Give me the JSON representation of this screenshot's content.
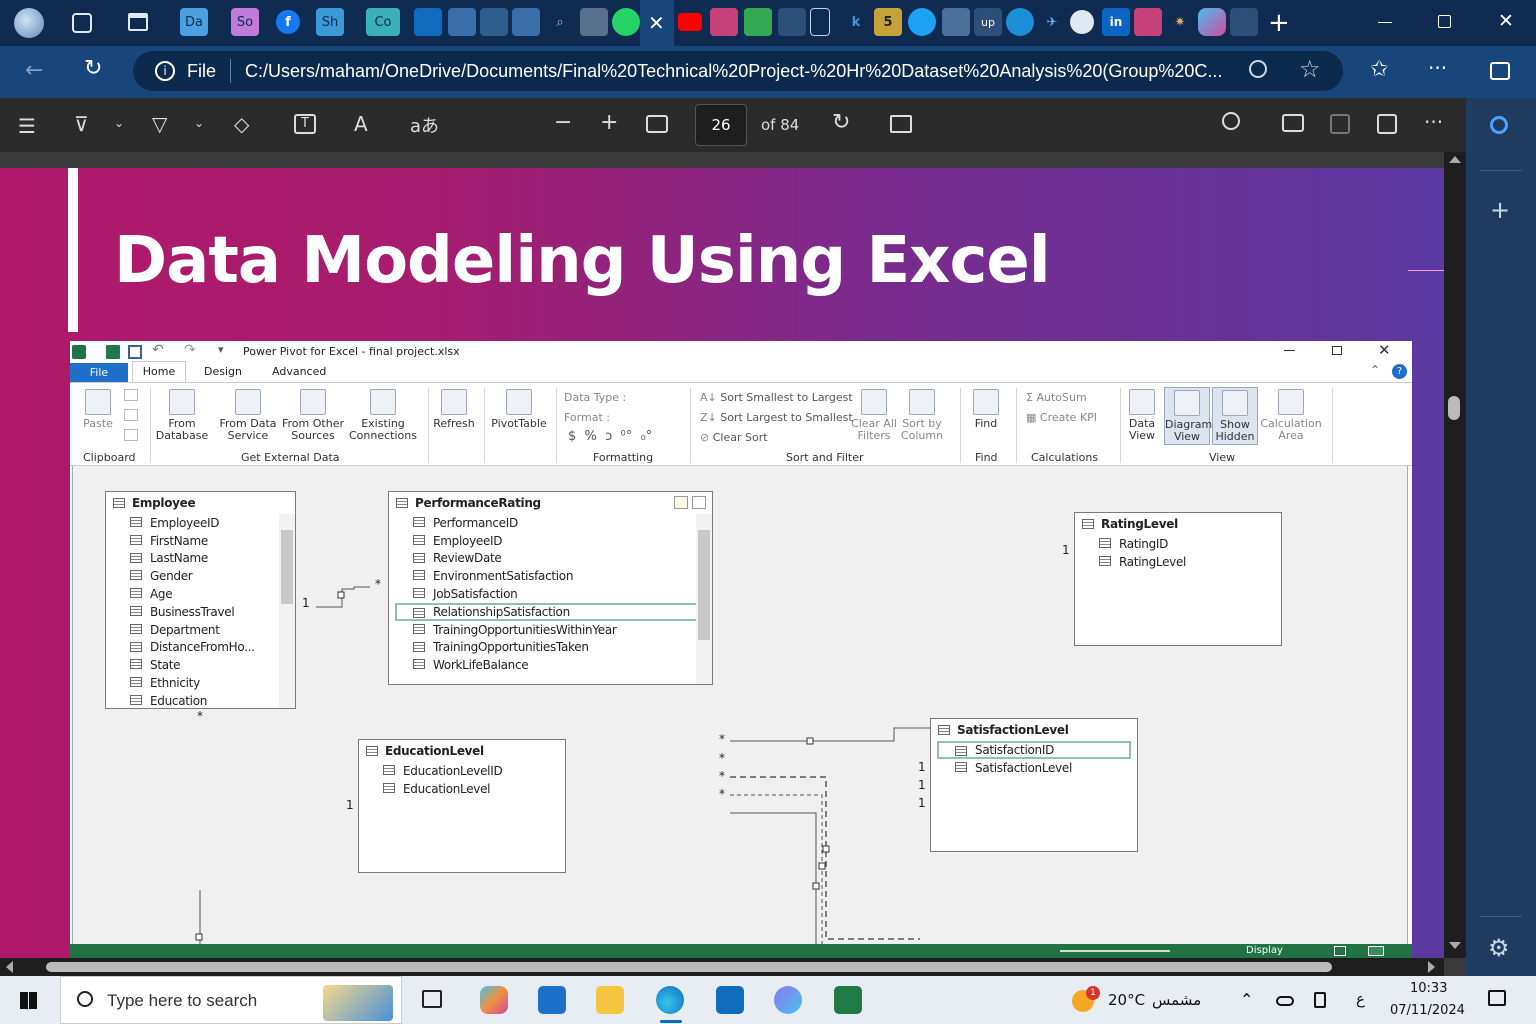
{
  "browser": {
    "tabs": [
      {
        "label": "Da",
        "color": "#4aa0e0"
      },
      {
        "label": "So",
        "color": "#c27bd8"
      },
      {
        "label": "Sh",
        "color": "#3a9ad6"
      },
      {
        "label": "Co",
        "color": "#3ab0b8"
      }
    ],
    "address": {
      "scheme_label": "File",
      "url": "C:/Users/maham/OneDrive/Documents/Final%20Technical%20Project-%20Hr%20Dataset%20Analysis%20(Group%20C..."
    }
  },
  "pdf_toolbar": {
    "page_current": "26",
    "page_total_label": "of 84"
  },
  "slide": {
    "title": "Data Modeling Using Excel"
  },
  "excel": {
    "window_title": "Power Pivot for Excel - final project.xlsx",
    "tabs": [
      "File",
      "Home",
      "Design",
      "Advanced"
    ],
    "ribbon": {
      "paste": "Paste",
      "from_database": [
        "From",
        "Database"
      ],
      "from_data_service": [
        "From Data",
        "Service"
      ],
      "from_other_sources": [
        "From Other",
        "Sources"
      ],
      "existing_connections": [
        "Existing",
        "Connections"
      ],
      "refresh": "Refresh",
      "pivottable": "PivotTable",
      "data_type": "Data Type :",
      "format": "Format :",
      "format_symbols": "$  %  ɔ  ⁰°  ₀°",
      "sort_small": "Sort Smallest to Largest",
      "sort_large": "Sort Largest to Smallest",
      "clear_sort": "Clear Sort",
      "clear_all_filters": [
        "Clear All",
        "Filters"
      ],
      "sort_by_column": [
        "Sort by",
        "Column"
      ],
      "find": "Find",
      "autosum": "AutoSum",
      "create_kpi": "Create KPI",
      "data_view": [
        "Data",
        "View"
      ],
      "diagram_view": [
        "Diagram",
        "View"
      ],
      "show_hidden": [
        "Show",
        "Hidden"
      ],
      "calculation_area": [
        "Calculation",
        "Area"
      ],
      "groups": {
        "clipboard": "Clipboard",
        "get_external": "Get External Data",
        "formatting": "Formatting",
        "sort_filter": "Sort and Filter",
        "find": "Find",
        "calculations": "Calculations",
        "view": "View"
      }
    },
    "tables": {
      "employee": {
        "name": "Employee",
        "fields": [
          "EmployeeID",
          "FirstName",
          "LastName",
          "Gender",
          "Age",
          "BusinessTravel",
          "Department",
          "DistanceFromHo...",
          "State",
          "Ethnicity",
          "Education"
        ]
      },
      "performance": {
        "name": "PerformanceRating",
        "fields": [
          "PerformanceID",
          "EmployeeID",
          "ReviewDate",
          "EnvironmentSatisfaction",
          "JobSatisfaction",
          "RelationshipSatisfaction",
          "TrainingOpportunitiesWithinYear",
          "TrainingOpportunitiesTaken",
          "WorkLifeBalance"
        ]
      },
      "rating": {
        "name": "RatingLevel",
        "fields": [
          "RatingID",
          "RatingLevel"
        ]
      },
      "education": {
        "name": "EducationLevel",
        "fields": [
          "EducationLevelID",
          "EducationLevel"
        ]
      },
      "satisfaction": {
        "name": "SatisfactionLevel",
        "fields": [
          "SatisfactionID",
          "SatisfactionLevel"
        ]
      }
    },
    "relation_marks": {
      "one": "1",
      "many": "*"
    },
    "statusbar": {
      "display": "Display"
    }
  },
  "taskbar": {
    "search_placeholder": "Type here to search",
    "weather_temp": "20°C",
    "weather_desc": "مشمس",
    "weather_badge": "1",
    "lang": "ع",
    "time": "10:33",
    "date": "07/11/2024"
  },
  "colors": {
    "tabstrip": "#0f2b52",
    "navbar": "#19467a",
    "pdf_toolbar": "#2b2b2b",
    "excel_green": "#217346",
    "file_tab": "#1e6fc9",
    "slide_pink": "#b0196a",
    "slide_purple": "#5a3aa0"
  }
}
